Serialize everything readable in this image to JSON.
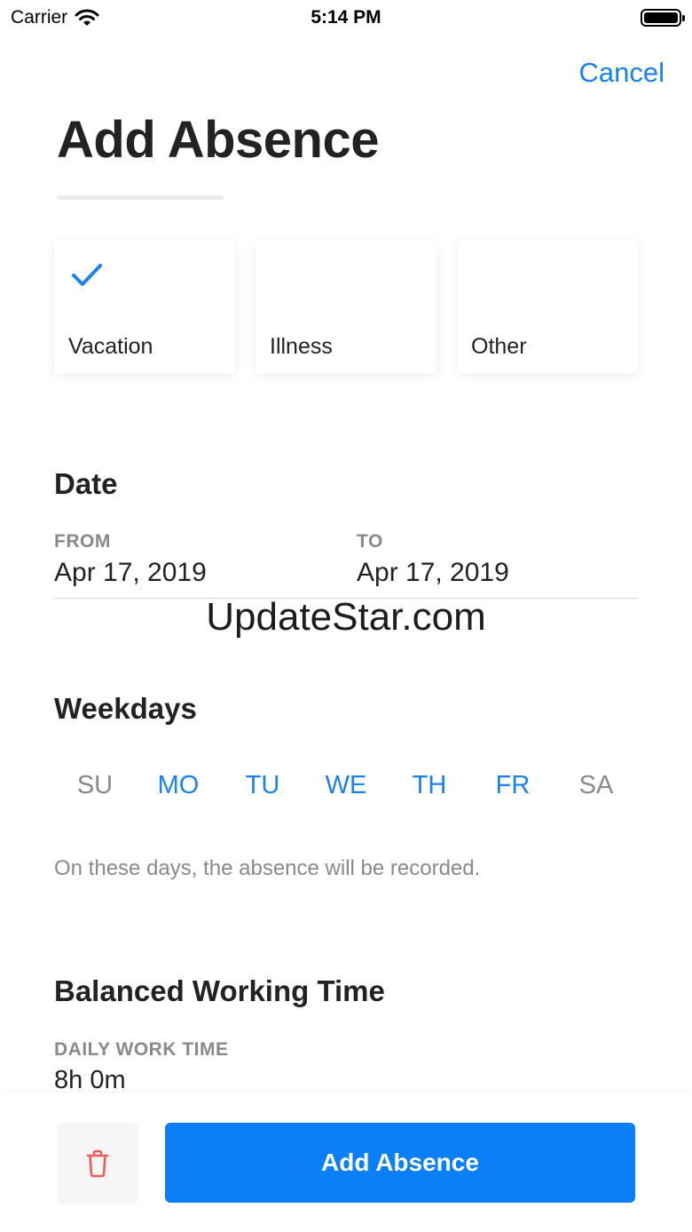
{
  "status_bar": {
    "carrier": "Carrier",
    "time": "5:14 PM"
  },
  "nav": {
    "cancel_label": "Cancel"
  },
  "header": {
    "title": "Add Absence"
  },
  "absence_types": [
    {
      "label": "Vacation",
      "selected": true
    },
    {
      "label": "Illness",
      "selected": false
    },
    {
      "label": "Other",
      "selected": false
    }
  ],
  "date": {
    "title": "Date",
    "from_label": "FROM",
    "from_value": "Apr 17, 2019",
    "to_label": "TO",
    "to_value": "Apr 17, 2019"
  },
  "watermark": "UpdateStar.com",
  "weekdays": {
    "title": "Weekdays",
    "days": [
      {
        "label": "SU",
        "active": false
      },
      {
        "label": "MO",
        "active": true
      },
      {
        "label": "TU",
        "active": true
      },
      {
        "label": "WE",
        "active": true
      },
      {
        "label": "TH",
        "active": true
      },
      {
        "label": "FR",
        "active": true
      },
      {
        "label": "SA",
        "active": false
      }
    ],
    "hint": "On these days, the absence will be recorded."
  },
  "balanced_time": {
    "title": "Balanced Working Time",
    "daily_label": "DAILY WORK TIME",
    "daily_value": "8h 0m"
  },
  "footer": {
    "add_label": "Add Absence"
  },
  "colors": {
    "accent": "#0b7ff5",
    "link": "#1a82f0",
    "muted": "#8a8a8e",
    "delete": "#f25a5a"
  }
}
